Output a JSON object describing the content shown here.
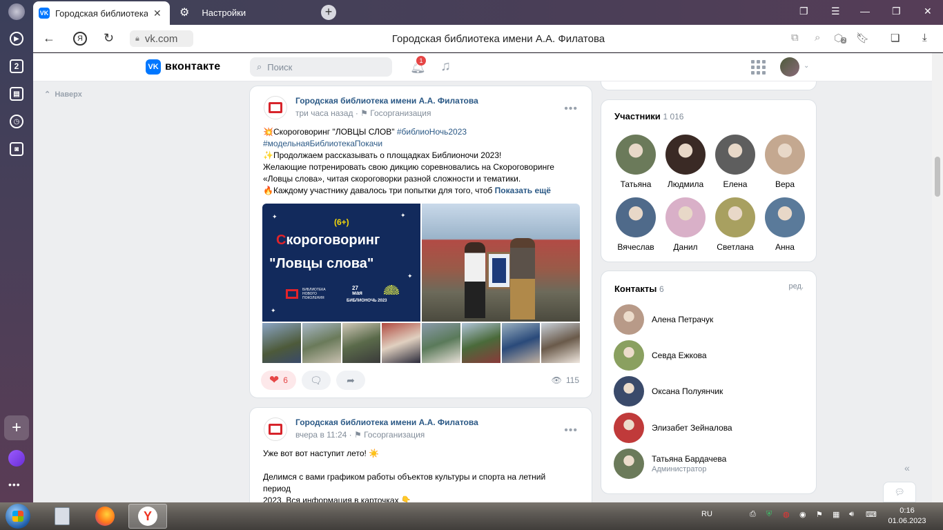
{
  "browser": {
    "active_tab_title": "Городская библиотека",
    "second_tab_title": "Настройки",
    "url": "vk.com",
    "page_title": "Городская библиотека имени А.А. Филатова",
    "rail_tab_count": "2",
    "badge_count": "2"
  },
  "vk": {
    "logo_text": "вконтакте",
    "search_placeholder": "Поиск",
    "notif_count": "1",
    "back_to_top": "Наверх"
  },
  "posts": [
    {
      "group": "Городская библиотека имени А.А. Филатова",
      "time": "три часа назад",
      "category": "Госорганизация",
      "lines": [
        {
          "emoji": "💥",
          "text": "Скороговоринг \"ЛОВЦЫ СЛОВ\" ",
          "tag": "#библиоНочь2023"
        },
        {
          "emoji": "",
          "text": "",
          "tag": "#модельнаяБиблиотекаПокачи"
        },
        {
          "emoji": "✨",
          "text": "Продолжаем рассказывать о площадках Библионочи 2023!",
          "tag": ""
        },
        {
          "emoji": "",
          "text": "Желающие потренировать свою дикцию соревновались на Скороговоринге",
          "tag": ""
        },
        {
          "emoji": "",
          "text": "«Ловцы слова», читая скороговорки разной сложности и тематики.",
          "tag": ""
        },
        {
          "emoji": "🔥",
          "text": "Каждому участнику давалось три попытки для того, чтоб",
          "tag": ""
        }
      ],
      "show_more": "Показать ещё",
      "poster": {
        "age": "(6+)",
        "first_letter": "С",
        "line1_rest": "короговоринг",
        "line2": "\"Ловцы слова\"",
        "library_lines": [
          "БИБЛИОТЕКА",
          "НОВОГО",
          "ПОКОЛЕНИЯ"
        ],
        "date_number": "27",
        "date_month": "мая",
        "event": "БИБЛИОНОЧЬ 2023"
      },
      "likes": "6",
      "views": "115"
    },
    {
      "group": "Городская библиотека имени А.А. Филатова",
      "time": "вчера в 11:24",
      "category": "Госорганизация",
      "line1": "Уже вот вот наступит лето! ☀️",
      "line2": "Делимся с вами графиком работы объектов культуры и спорта на летний период",
      "line3": "2023. Вся информация в карточках 👇"
    }
  ],
  "members": {
    "title": "Участники",
    "count": "1 016",
    "items": [
      {
        "name": "Татьяна",
        "color": "#6b7a5a"
      },
      {
        "name": "Людмила",
        "color": "#3a2a25"
      },
      {
        "name": "Елена",
        "color": "#5e5e5e"
      },
      {
        "name": "Вера",
        "color": "#c4a890"
      },
      {
        "name": "Вячеслав",
        "color": "#4f6a8a"
      },
      {
        "name": "Данил",
        "color": "#d9b0c8"
      },
      {
        "name": "Светлана",
        "color": "#a8a060"
      },
      {
        "name": "Анна",
        "color": "#5a7a9a"
      }
    ]
  },
  "contacts": {
    "title": "Контакты",
    "count": "6",
    "edit_label": "ред.",
    "items": [
      {
        "name": "Алена Петрачук",
        "role": "",
        "color": "#b89a88"
      },
      {
        "name": "Севда Ежкова",
        "role": "",
        "color": "#8aa060"
      },
      {
        "name": "Оксана Полуянчик",
        "role": "",
        "color": "#3a4a6a"
      },
      {
        "name": "Элизабет Зейналова",
        "role": "",
        "color": "#c03a3a"
      },
      {
        "name": "Татьяна Бардачева",
        "role": "Администратор",
        "color": "#6b7a5a"
      }
    ]
  },
  "taskbar": {
    "lang": "RU",
    "time": "0:16",
    "date": "01.06.2023"
  }
}
